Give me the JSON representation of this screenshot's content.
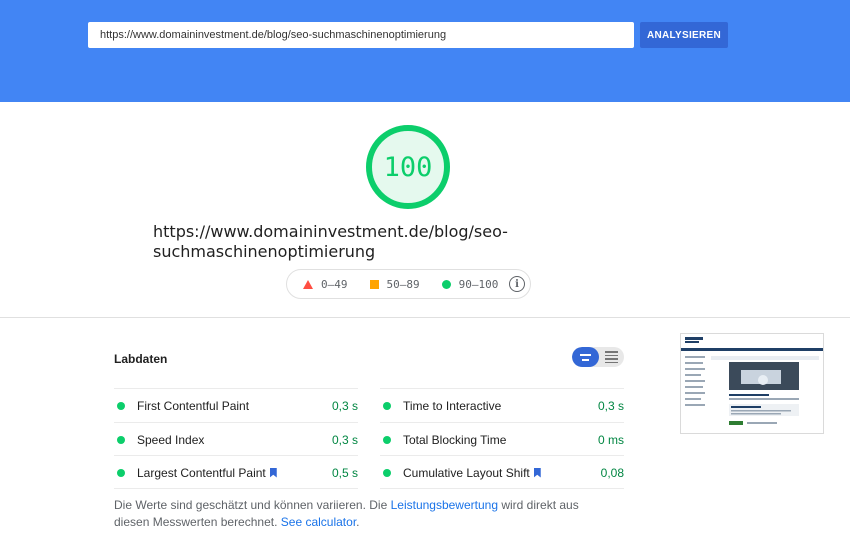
{
  "search": {
    "url_value": "https://www.domaininvestment.de/blog/seo-suchmaschinenoptimierung",
    "analyze_label": "ANALYSIEREN"
  },
  "score": {
    "value": "100",
    "fraction": 1.0,
    "color": "#0cce6b"
  },
  "page_url": "https://www.domaininvestment.de/blog/seo-suchmaschinenoptimierung",
  "legend": {
    "fail": "0–49",
    "average": "50–89",
    "pass": "90–100",
    "fail_color": "#ff4e42",
    "average_color": "#ffa400",
    "pass_color": "#0cce6b",
    "info_icon": "info-icon"
  },
  "lab": {
    "title": "Labdaten",
    "metrics_left": [
      {
        "label": "First Contentful Paint",
        "value": "0,3 s",
        "bookmark": false
      },
      {
        "label": "Speed Index",
        "value": "0,3 s",
        "bookmark": false
      },
      {
        "label": "Largest Contentful Paint",
        "value": "0,5 s",
        "bookmark": true
      }
    ],
    "metrics_right": [
      {
        "label": "Time to Interactive",
        "value": "0,3 s",
        "bookmark": false
      },
      {
        "label": "Total Blocking Time",
        "value": "0 ms",
        "bookmark": false
      },
      {
        "label": "Cumulative Layout Shift",
        "value": "0,08",
        "bookmark": true
      }
    ]
  },
  "note": {
    "text_before": "Die Werte sind geschätzt und können variieren. Die ",
    "link1": "Leistungsbewertung",
    "text_middle": " wird direkt aus diesen Messwerten berechnet. ",
    "link2": "See calculator",
    "text_after": "."
  },
  "thumbnail": {
    "headline": "SEO – Suchmaschinenoptimierung"
  },
  "colors": {
    "header_bg": "#4285f4",
    "button_bg": "#3367d6",
    "pass_text": "#018642",
    "link": "#1a73e8"
  }
}
